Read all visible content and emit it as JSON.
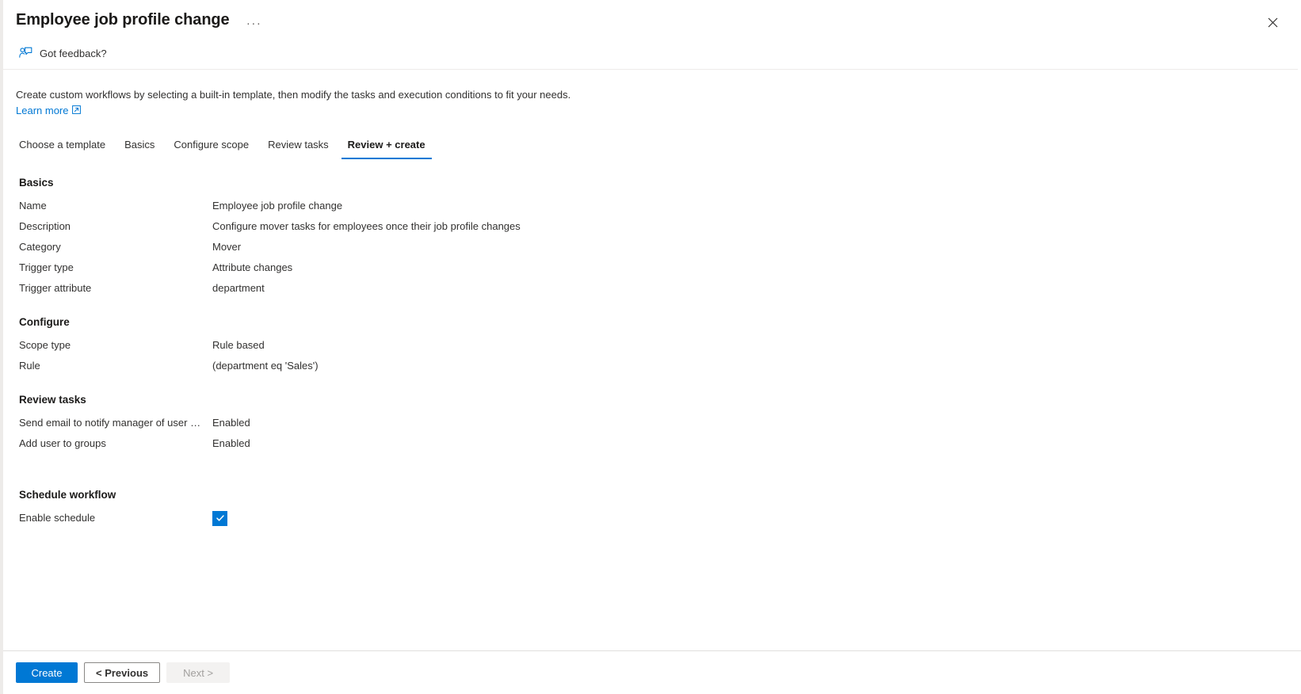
{
  "header": {
    "title": "Employee job profile change",
    "more_options_label": "···",
    "close_label": "Close",
    "accent_color": "#0078d4"
  },
  "feedback": {
    "label": "Got feedback?",
    "icon": "feedback-person-icon"
  },
  "intro": {
    "description": "Create custom workflows by selecting a built-in template, then modify the tasks and execution conditions to fit your needs.",
    "learn_more_label": "Learn more",
    "learn_more_icon": "external-link-icon"
  },
  "tabs": [
    {
      "label": "Choose a template",
      "selected": false
    },
    {
      "label": "Basics",
      "selected": false
    },
    {
      "label": "Configure scope",
      "selected": false
    },
    {
      "label": "Review tasks",
      "selected": false
    },
    {
      "label": "Review + create",
      "selected": true
    }
  ],
  "sections": [
    {
      "title": "Basics",
      "rows": [
        {
          "key": "Name",
          "value": "Employee job profile change"
        },
        {
          "key": "Description",
          "value": "Configure mover tasks for employees once their job profile changes"
        },
        {
          "key": "Category",
          "value": "Mover"
        },
        {
          "key": "Trigger type",
          "value": "Attribute changes"
        },
        {
          "key": "Trigger attribute",
          "value": "department"
        }
      ]
    },
    {
      "title": "Configure",
      "rows": [
        {
          "key": "Scope type",
          "value": "Rule based"
        },
        {
          "key": "Rule",
          "value": "(department eq 'Sales')"
        }
      ]
    },
    {
      "title": "Review tasks",
      "rows": [
        {
          "key": "Send email to notify manager of user mo...",
          "value": "Enabled"
        },
        {
          "key": "Add user to groups",
          "value": "Enabled"
        }
      ]
    }
  ],
  "schedule": {
    "title": "Schedule workflow",
    "enable_label": "Enable schedule",
    "enable_checked": true,
    "checkbox_color": "#0078d4"
  },
  "footer": {
    "create_label": "Create",
    "previous_label": "< Previous",
    "next_label": "Next >",
    "next_disabled": true
  }
}
